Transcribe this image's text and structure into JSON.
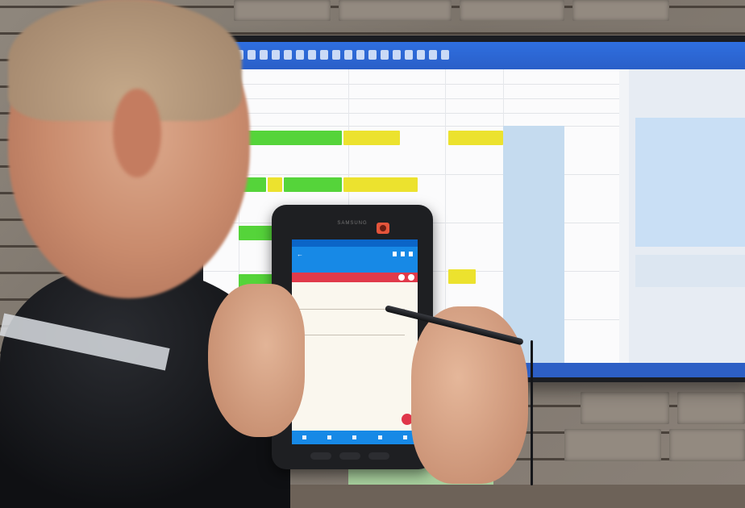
{
  "scene": {
    "description_tag": ""
  },
  "monitor": {
    "app_title": "",
    "bar_colors": {
      "green": "#55d43a",
      "yellow": "#ece22e",
      "toolbar": "#2a5fc8"
    }
  },
  "tablet": {
    "brand": "SAMSUNG",
    "header_title": "",
    "header_subtitle": "",
    "section_label": "",
    "section_right": "",
    "field1_label": "",
    "field1_value": "",
    "field2_label": "",
    "field2_value": "",
    "footer_text": "",
    "colors": {
      "header": "#1789e6",
      "red_bar": "#e03a4a",
      "screen_bg": "#faf7ee"
    }
  }
}
